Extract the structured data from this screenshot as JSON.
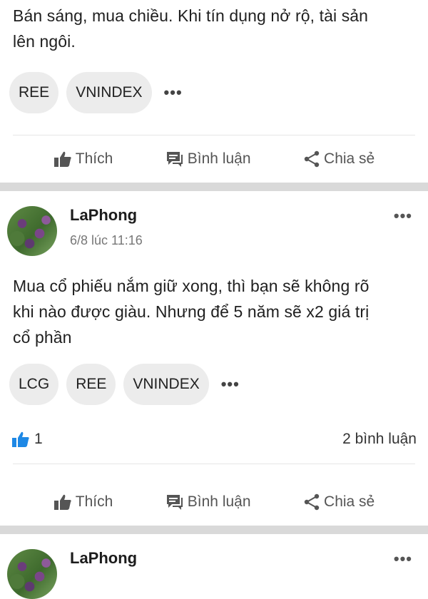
{
  "post1": {
    "text_line1": "Bán sáng, mua chiều. Khi tín dụng nở rộ, tài sản",
    "text_line2": "lên ngôi.",
    "tags": [
      "REE",
      "VNINDEX"
    ]
  },
  "post2": {
    "username": "LaPhong",
    "timestamp": "6/8 lúc 11:16",
    "text_line1": "Mua cổ phiếu nắm giữ xong, thì bạn sẽ không rõ",
    "text_line2": "khi nào được giàu. Nhưng để 5 năm sẽ x2 giá trị",
    "text_line3": "cổ phần",
    "tags": [
      "LCG",
      "REE",
      "VNINDEX"
    ],
    "like_count": "1",
    "comment_count": "2 bình luận"
  },
  "post3": {
    "username": "LaPhong"
  },
  "actions": {
    "like": "Thích",
    "comment": "Bình luận",
    "share": "Chia sẻ"
  },
  "more_glyph": "•••",
  "icons": {
    "like": "thumbs-up-icon",
    "comment": "comment-icon",
    "share": "share-icon",
    "liked": "thumbs-up-filled-icon",
    "more": "more-dots-icon"
  },
  "colors": {
    "like_blue": "#1e88e5",
    "separator": "#d9d9d9",
    "chip": "#ececec"
  }
}
